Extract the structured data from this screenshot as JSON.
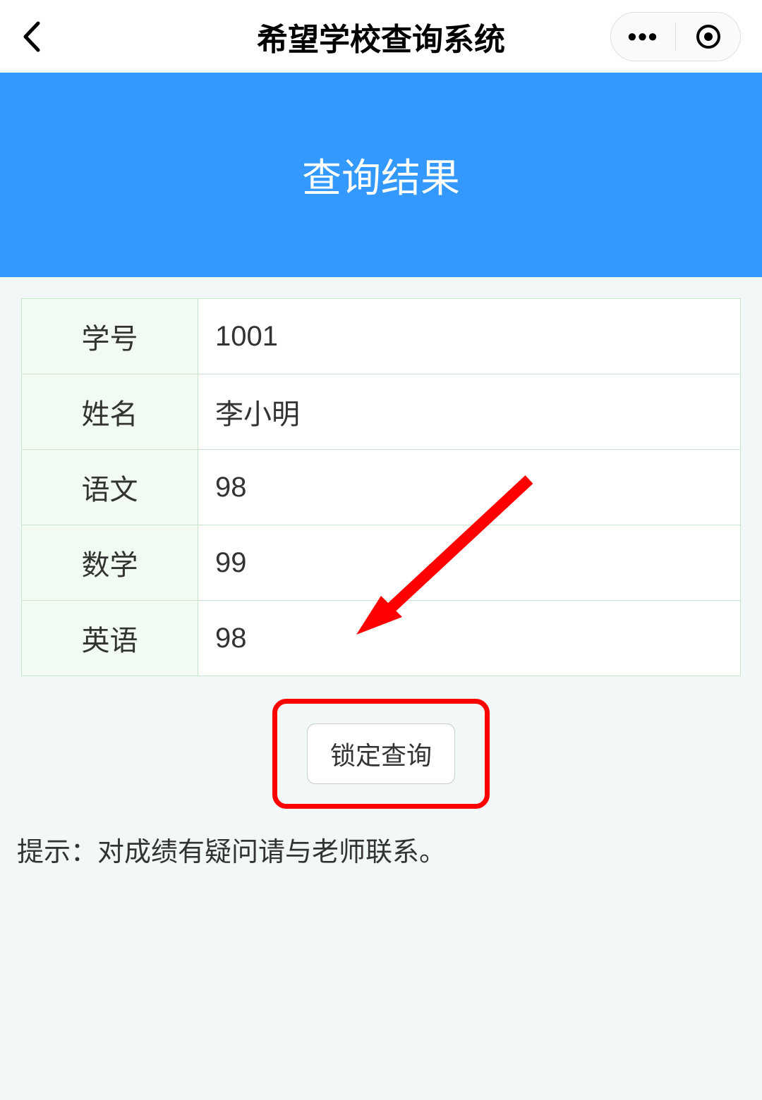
{
  "header": {
    "title": "希望学校查询系统"
  },
  "banner": {
    "title": "查询结果"
  },
  "result": {
    "rows": [
      {
        "label": "学号",
        "value": "1001"
      },
      {
        "label": "姓名",
        "value": "李小明"
      },
      {
        "label": "语文",
        "value": "98"
      },
      {
        "label": "数学",
        "value": "99"
      },
      {
        "label": "英语",
        "value": "98"
      }
    ]
  },
  "button": {
    "lock_label": "锁定查询"
  },
  "hint": {
    "text": "提示：对成绩有疑问请与老师联系。"
  }
}
